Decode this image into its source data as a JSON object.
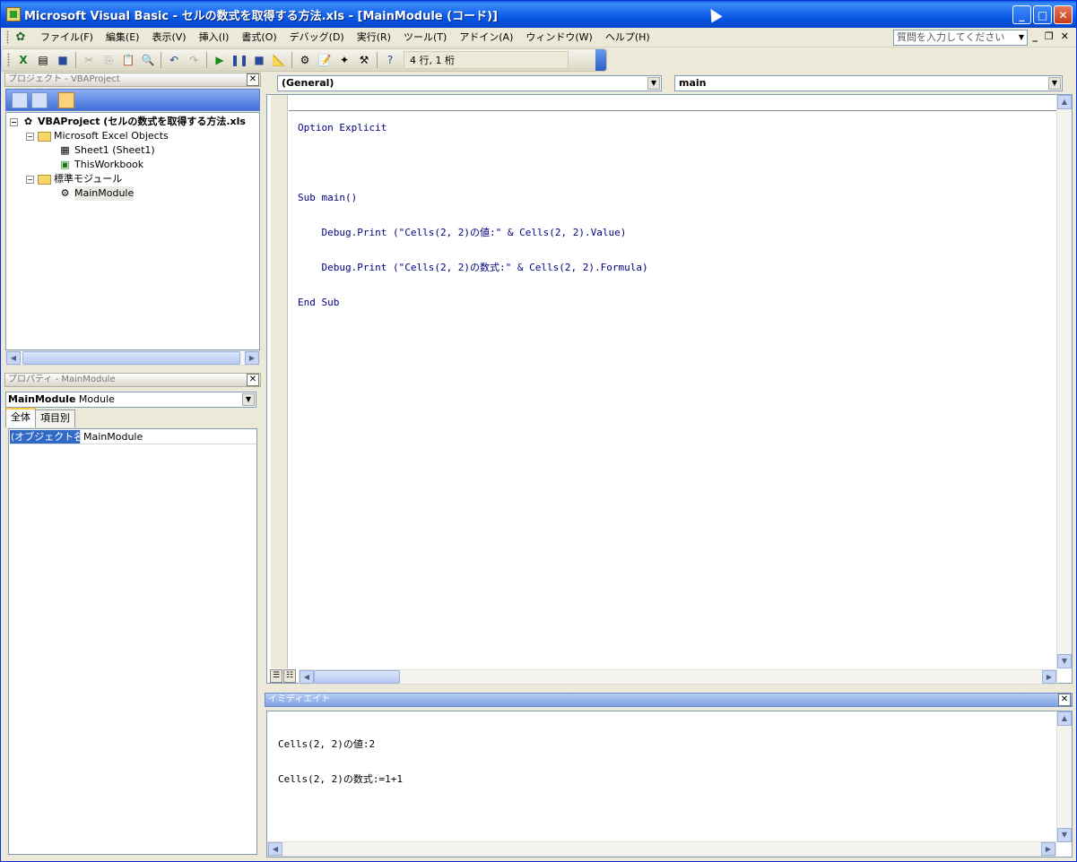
{
  "window": {
    "title": "Microsoft Visual Basic - セルの数式を取得する方法.xls - [MainModule (コード)]"
  },
  "menu": {
    "items": [
      "ファイル(F)",
      "編集(E)",
      "表示(V)",
      "挿入(I)",
      "書式(O)",
      "デバッグ(D)",
      "実行(R)",
      "ツール(T)",
      "アドイン(A)",
      "ウィンドウ(W)",
      "ヘルプ(H)"
    ],
    "ask_placeholder": "質問を入力してください"
  },
  "toolbar": {
    "position_label": "4 行, 1 桁"
  },
  "project_panel": {
    "title": "プロジェクト - VBAProject",
    "tree": {
      "root": "VBAProject (セルの数式を取得する方法.xls",
      "excel_objects": "Microsoft Excel Objects",
      "sheet1": "Sheet1 (Sheet1)",
      "this_workbook": "ThisWorkbook",
      "std_modules": "標準モジュール",
      "main_module": "MainModule"
    }
  },
  "properties_panel": {
    "title": "プロパティ - MainModule",
    "object_combo": "MainModule",
    "object_type": "Module",
    "tabs": [
      "全体",
      "項目別"
    ],
    "rows": [
      {
        "key": "(オブジェクト名)",
        "value": "MainModule"
      }
    ]
  },
  "code_window": {
    "object_combo": "(General)",
    "proc_combo": "main",
    "lines": [
      "Option Explicit",
      "",
      "Sub main()",
      "    Debug.Print (\"Cells(2, 2)の値:\" & Cells(2, 2).Value)",
      "    Debug.Print (\"Cells(2, 2)の数式:\" & Cells(2, 2).Formula)",
      "End Sub"
    ]
  },
  "immediate_window": {
    "title": "イミディエイト",
    "lines": [
      "Cells(2, 2)の値:2",
      "Cells(2, 2)の数式:=1+1"
    ]
  },
  "colors": {
    "titlebar": "#0553e0",
    "selection": "#316ac5",
    "keyword": "#00007f"
  }
}
